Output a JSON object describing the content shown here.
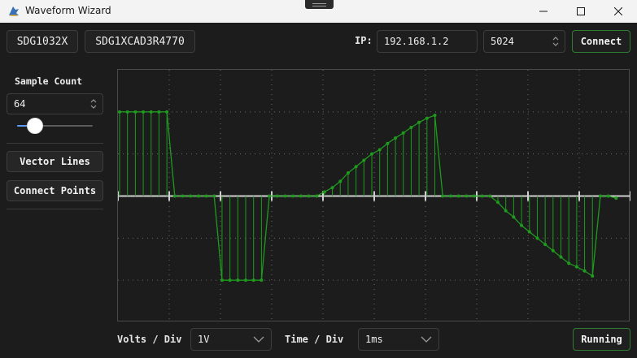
{
  "window": {
    "title": "Waveform Wizard",
    "app_icon": "wizard-hat-icon",
    "controls": [
      "minimize-icon",
      "maximize-icon",
      "close-icon"
    ]
  },
  "device": {
    "model": "SDG1032X",
    "serial": "SDG1XCAD3R4770",
    "ip_label": "IP:",
    "ip_value": "192.168.1.2",
    "port_value": "5024",
    "connect_label": "Connect"
  },
  "sidebar": {
    "sample_count_label": "Sample Count",
    "sample_count_value": "64",
    "slider": {
      "min": 0,
      "max": 1,
      "value": 0.24
    },
    "vector_lines_label": "Vector Lines",
    "connect_points_label": "Connect Points"
  },
  "bottom": {
    "volts_label": "Volts / Div",
    "volts_value": "1V",
    "time_label": "Time / Div",
    "time_value": "1ms",
    "running_label": "Running"
  },
  "colors": {
    "trace": "#1f9a1f",
    "grid": "#6a6a6a",
    "axis": "#cfcfcf",
    "accent": "#5b9bf5",
    "connect_border": "#2e7d32"
  },
  "chart_data": {
    "type": "line",
    "title": "",
    "xlabel": "",
    "ylabel": "",
    "x": [
      0,
      1,
      2,
      3,
      4,
      5,
      6,
      7,
      8,
      9,
      10,
      11,
      12,
      13,
      14,
      15,
      16,
      17,
      18,
      19,
      20,
      21,
      22,
      23,
      24,
      25,
      26,
      27,
      28,
      29,
      30,
      31,
      32,
      33,
      34,
      35,
      36,
      37,
      38,
      39,
      40,
      41,
      42,
      43,
      44,
      45,
      46,
      47,
      48,
      49,
      50,
      51,
      52,
      53,
      54,
      55,
      56,
      57,
      58,
      59,
      60,
      61,
      62,
      63
    ],
    "values": [
      2,
      2,
      2,
      2,
      2,
      2,
      2,
      0,
      0,
      0,
      0,
      0,
      0,
      -2,
      -2,
      -2,
      -2,
      -2,
      -2,
      0,
      0,
      0,
      0,
      0,
      0,
      0,
      0.1,
      0.2,
      0.35,
      0.55,
      0.7,
      0.85,
      1,
      1.1,
      1.25,
      1.38,
      1.5,
      1.63,
      1.75,
      1.85,
      1.92,
      0,
      0,
      0,
      0,
      0,
      0,
      0,
      -0.15,
      -0.35,
      -0.5,
      -0.7,
      -0.85,
      -1,
      -1.15,
      -1.3,
      -1.45,
      -1.6,
      -1.68,
      -1.78,
      -1.9,
      0,
      0,
      -0.05
    ],
    "ylim": [
      -3,
      3
    ],
    "xlim": [
      0,
      64
    ],
    "grid": true,
    "vector_lines": true,
    "connect_points": true
  }
}
